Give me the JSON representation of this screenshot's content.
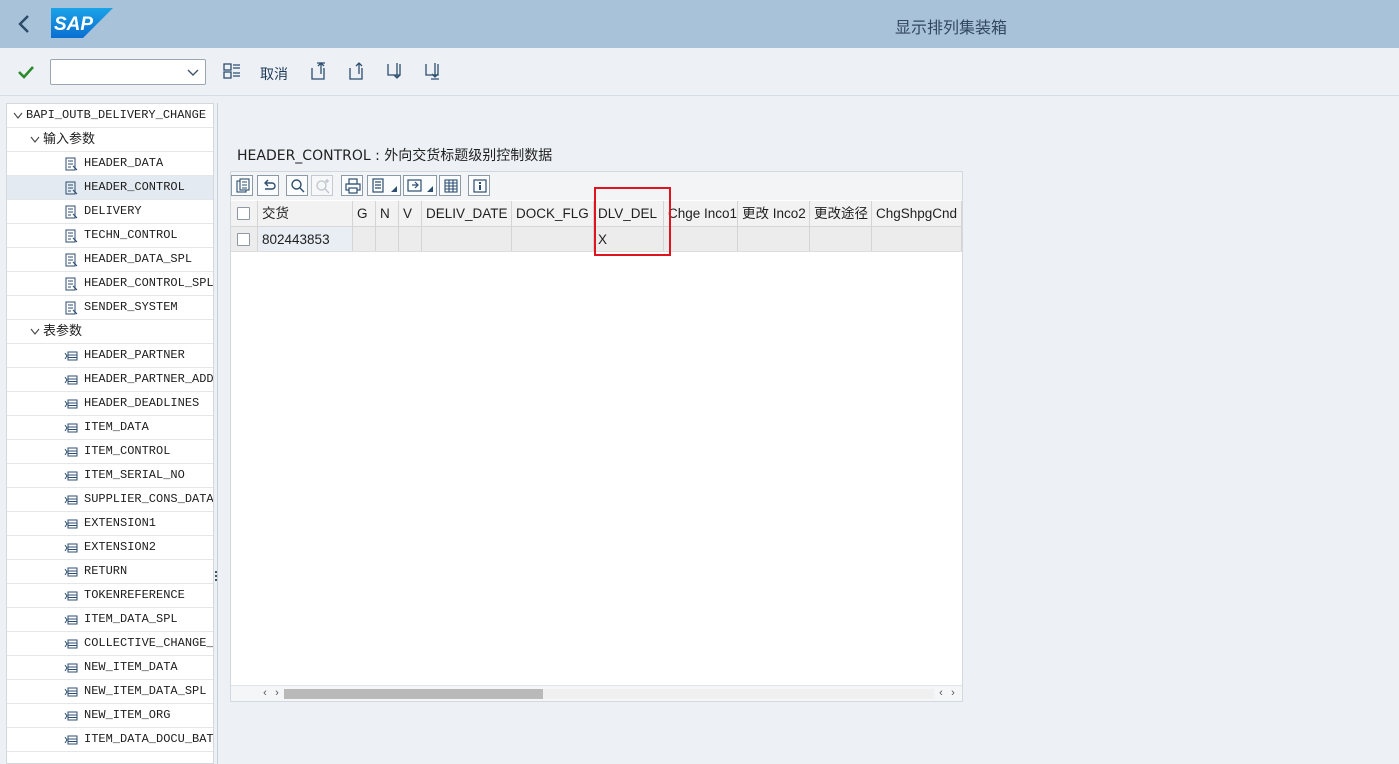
{
  "shell": {
    "title": "显示排列集装箱",
    "logo_text": "SAP",
    "brand_color": "#0a6ed1"
  },
  "toolbar": {
    "command_field_value": "",
    "cancel_label": "取消",
    "icons": [
      "check-icon",
      "command-dropdown",
      "grid-icon",
      "first-page-icon",
      "previous-page-icon",
      "next-page-icon",
      "last-page-icon"
    ]
  },
  "tree": {
    "root": "BAPI_OUTB_DELIVERY_CHANGE",
    "import_group": "输入参数",
    "import_params": [
      "HEADER_DATA",
      "HEADER_CONTROL",
      "DELIVERY",
      "TECHN_CONTROL",
      "HEADER_DATA_SPL",
      "HEADER_CONTROL_SPL",
      "SENDER_SYSTEM"
    ],
    "selected": "HEADER_CONTROL",
    "table_group": "表参数",
    "table_params": [
      "HEADER_PARTNER",
      "HEADER_PARTNER_ADDR",
      "HEADER_DEADLINES",
      "ITEM_DATA",
      "ITEM_CONTROL",
      "ITEM_SERIAL_NO",
      "SUPPLIER_CONS_DATA",
      "EXTENSION1",
      "EXTENSION2",
      "RETURN",
      "TOKENREFERENCE",
      "ITEM_DATA_SPL",
      "COLLECTIVE_CHANGE_ITEMS",
      "NEW_ITEM_DATA",
      "NEW_ITEM_DATA_SPL",
      "NEW_ITEM_ORG",
      "ITEM_DATA_DOCU_BATCH"
    ]
  },
  "content": {
    "section_title": "HEADER_CONTROL : 外向交货标题级别控制数据",
    "grid": {
      "columns": [
        "交货",
        "G",
        "N",
        "V",
        "DELIV_DATE",
        "DOCK_FLG",
        "DLV_DEL",
        "Chge Inco1",
        "更改 Inco2",
        "更改途径",
        "ChgShpgCnd"
      ],
      "rows": [
        [
          "802443853",
          "",
          "",
          "",
          "",
          "",
          "X",
          "",
          "",
          "",
          ""
        ]
      ],
      "highlighted_column": "DLV_DEL",
      "highlight_color": "#e0141e"
    }
  }
}
